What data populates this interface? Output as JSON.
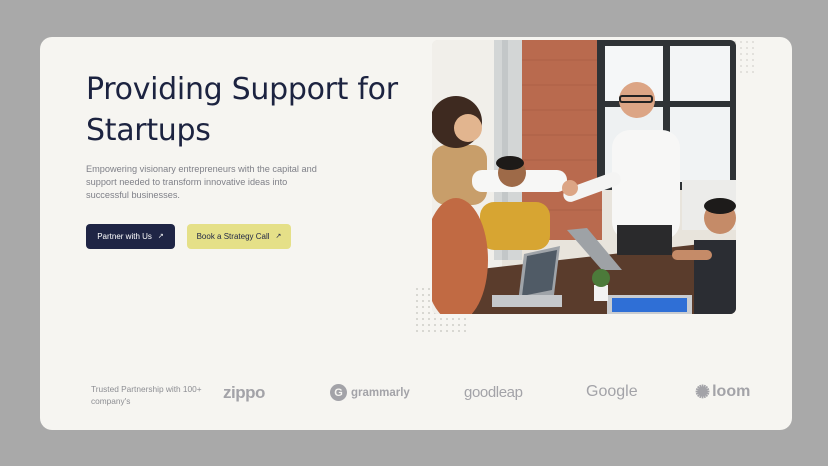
{
  "hero": {
    "title": "Providing Support for Startups",
    "subtitle": "Empowering visionary entrepreneurs with the capital and support needed to transform innovative ideas into successful businesses.",
    "primary_button": {
      "label": "Partner with Us",
      "icon": "arrow-up-right-icon"
    },
    "secondary_button": {
      "label": "Book a Strategy Call",
      "icon": "arrow-up-right-icon"
    }
  },
  "partners": {
    "label": "Trusted Partnership with 100+ company's",
    "logos": [
      "zippo",
      "grammarly",
      "goodleap",
      "Google",
      "loom"
    ]
  },
  "colors": {
    "page_bg": "#a9a9a9",
    "card_bg": "#f6f5f1",
    "navy": "#1f2545",
    "yellow": "#e5e088",
    "logo_gray": "#a3a3a8"
  }
}
